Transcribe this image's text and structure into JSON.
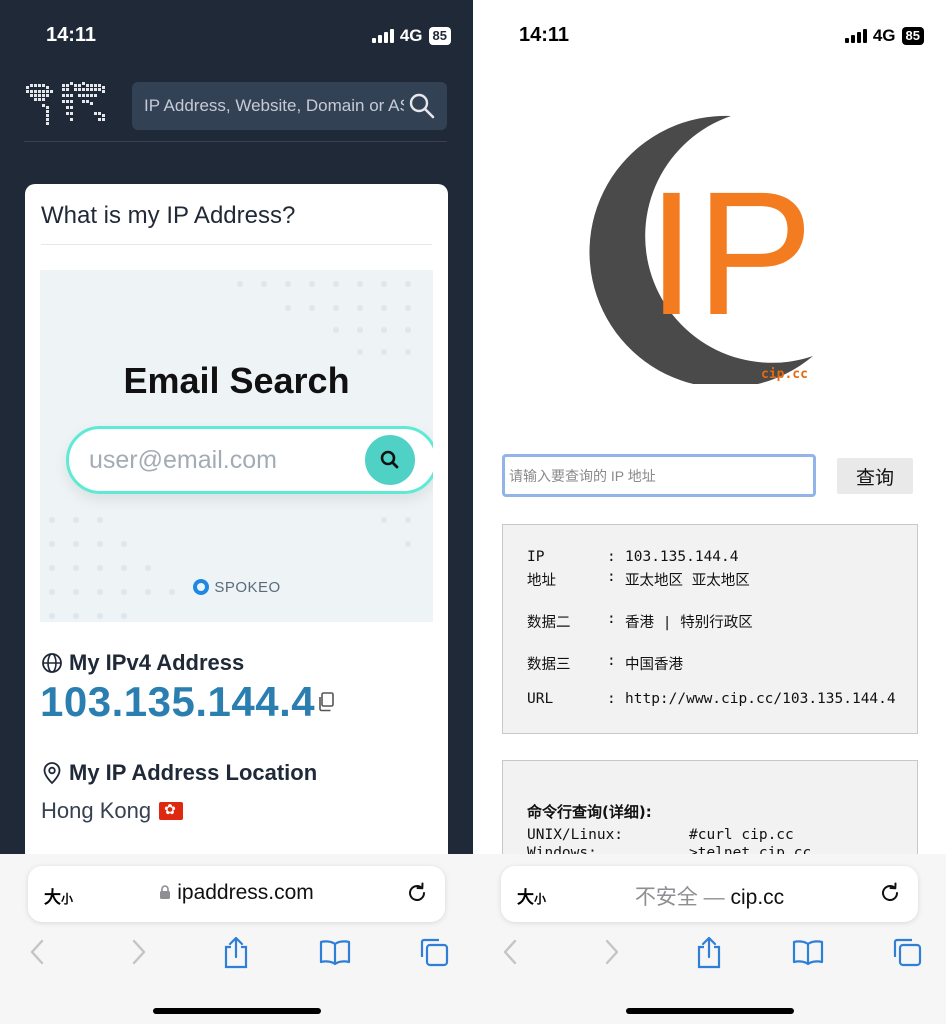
{
  "left": {
    "status": {
      "time": "14:11",
      "network": "4G",
      "battery": "85"
    },
    "search": {
      "placeholder": "IP Address, Website, Domain or ASN"
    },
    "card": {
      "title": "What is my IP Address?",
      "ad": {
        "title": "Email Search",
        "placeholder": "user@email.com",
        "brand": "SPOKEO"
      },
      "ipv4_label": "My IPv4 Address",
      "ipv4_value": "103.135.144.4",
      "location_label": "My IP Address Location",
      "location_value": "Hong Kong"
    },
    "bottom": {
      "text_size": "大",
      "text_size_small": "小",
      "url": "ipaddress.com"
    }
  },
  "right": {
    "status": {
      "time": "14:11",
      "network": "4G",
      "battery": "85"
    },
    "logo": {
      "text": "IP",
      "caption": "cip.cc"
    },
    "query": {
      "placeholder": "请输入要查询的 IP 地址",
      "button": "查询"
    },
    "result": [
      {
        "key": "IP",
        "value": "103.135.144.4"
      },
      {
        "key": "地址",
        "value": "亚太地区  亚太地区"
      },
      {
        "key": "数据二",
        "value": "香港 | 特别行政区"
      },
      {
        "key": "数据三",
        "value": "中国香港"
      },
      {
        "key": "URL",
        "value": "http://www.cip.cc/103.135.144.4"
      }
    ],
    "separator": ":",
    "command": {
      "title": "命令行查询(详细):",
      "rows": [
        {
          "key": "UNIX/Linux:",
          "value": "#curl cip.cc"
        },
        {
          "key": "Windows:",
          "value": ">telnet cip.cc"
        }
      ]
    },
    "bottom": {
      "text_size": "大",
      "text_size_small": "小",
      "insecure": "不安全",
      "dash": " — ",
      "url": "cip.cc"
    }
  },
  "icons": [
    "world-map-icon",
    "search-icon",
    "globe-icon",
    "pin-icon",
    "copy-icon",
    "lock-icon",
    "reload-icon",
    "back-icon",
    "forward-icon",
    "share-icon",
    "bookmarks-icon",
    "tabs-icon"
  ],
  "colors": {
    "left_bg": "#1f2937",
    "accent_blue": "#2a7fb0",
    "teal": "#4fd1c5",
    "ip_orange": "#f47c20",
    "ios_blue": "#2f7fd6"
  }
}
